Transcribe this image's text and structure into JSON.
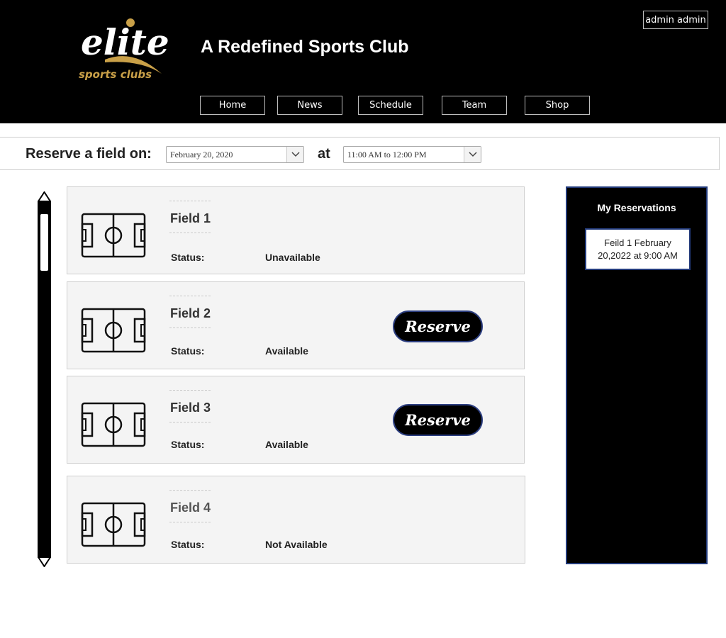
{
  "header": {
    "logo_word": "elite",
    "logo_sub": "sports clubs",
    "site_title": "A Redefined Sports Club",
    "user_label": "admin admin",
    "nav": [
      {
        "label": "Home"
      },
      {
        "label": "News"
      },
      {
        "label": "Schedule"
      },
      {
        "label": "Team"
      },
      {
        "label": "Shop"
      }
    ]
  },
  "reserve_bar": {
    "label": "Reserve a field on:",
    "date_value": "February 20, 2020",
    "at_label": "at",
    "time_value": "11:00 AM to 12:00 PM"
  },
  "fields": [
    {
      "name": "Field 1",
      "status_label": "Status:",
      "status": "Unavailable",
      "button": ""
    },
    {
      "name": "Field 2",
      "status_label": "Status:",
      "status": "Available",
      "button": "Reserve"
    },
    {
      "name": "Field 3",
      "status_label": "Status:",
      "status": "Available",
      "button": "Reserve"
    },
    {
      "name": "Field 4",
      "status_label": "Status:",
      "status": "Not Available",
      "button": ""
    }
  ],
  "reservations": {
    "title": "My Reservations",
    "items": [
      "Feild 1 February 20,2022 at 9:00 AM"
    ]
  },
  "colors": {
    "header_bg": "#000000",
    "logo_gold": "#c9a048",
    "panel_border": "#223a7a"
  }
}
